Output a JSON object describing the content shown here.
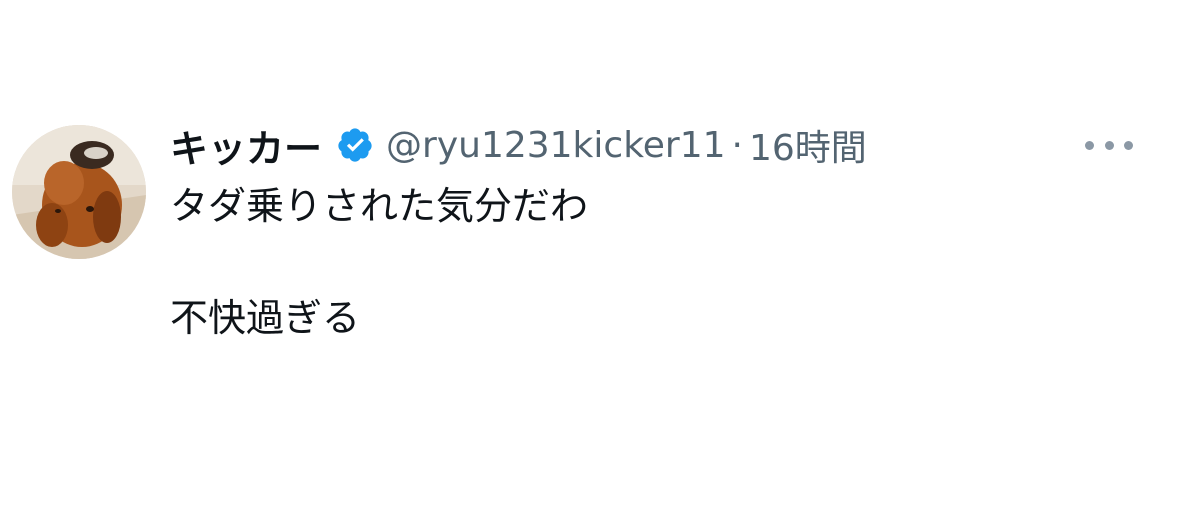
{
  "tweet": {
    "display_name": "キッカー",
    "verified_icon": "verified-badge-icon",
    "handle": "@ryu1231kicker11",
    "separator": "·",
    "time": "16時間",
    "more_icon": "more-options-icon",
    "body_lines": [
      "タダ乗りされた気分だわ",
      "",
      "不快過ぎる"
    ]
  },
  "colors": {
    "verified": "#1d9bf0",
    "secondary_text": "#536471",
    "primary_text": "#0f1419"
  }
}
